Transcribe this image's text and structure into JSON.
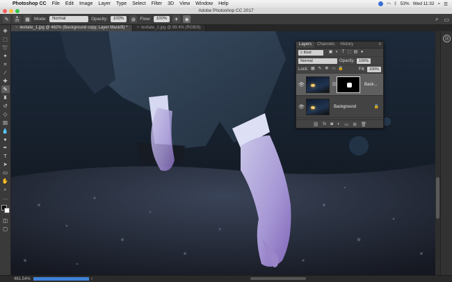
{
  "menubar": {
    "app": "Photoshop CC",
    "items": [
      "File",
      "Edit",
      "Image",
      "Layer",
      "Type",
      "Select",
      "Filter",
      "3D",
      "View",
      "Window",
      "Help"
    ],
    "battery": "53%",
    "clock": "Wed 11:32"
  },
  "window": {
    "title": "Adobe Photoshop CC 2017"
  },
  "options": {
    "brush_size": "25",
    "mode_label": "Mode:",
    "mode_value": "Normal",
    "opacity_label": "Opacity:",
    "opacity_value": "100%",
    "flow_label": "Flow:",
    "flow_value": "100%"
  },
  "tabs": [
    {
      "label": "levitate_1.jpg @ 462% (Background copy, Layer Mask/8) *",
      "active": true
    },
    {
      "label": "levitate_2.jpg @ 89.4% (RGB/8)",
      "active": false
    }
  ],
  "tools": [
    "move-icon",
    "marquee-icon",
    "lasso-icon",
    "quick-select-icon",
    "crop-icon",
    "eyedropper-icon",
    "healing-icon",
    "brush-icon",
    "stamp-icon",
    "history-brush-icon",
    "eraser-icon",
    "gradient-icon",
    "blur-icon",
    "dodge-icon",
    "pen-icon",
    "type-icon",
    "path-select-icon",
    "shape-icon",
    "hand-icon",
    "zoom-icon",
    "more-icon"
  ],
  "active_tool": "brush-icon",
  "status": {
    "zoom": "461.54%"
  },
  "layers_panel": {
    "tabs": [
      "Layers",
      "Channels",
      "History"
    ],
    "kind_label": "Kind",
    "blend_mode": "Normal",
    "opacity_label": "Opacity:",
    "opacity_value": "100%",
    "lock_label": "Lock:",
    "fill_label": "Fill:",
    "fill_value": "100%",
    "layers": [
      {
        "name": "Back...",
        "selected": true,
        "has_mask": true
      },
      {
        "name": "Background",
        "selected": false,
        "locked": true
      }
    ],
    "footer_icons": [
      "link-icon",
      "fx-icon",
      "mask-icon",
      "adjustment-icon",
      "group-icon",
      "new-layer-icon",
      "trash-icon"
    ]
  },
  "colors": {
    "progress": "#3d82d8",
    "panel": "#434343"
  }
}
